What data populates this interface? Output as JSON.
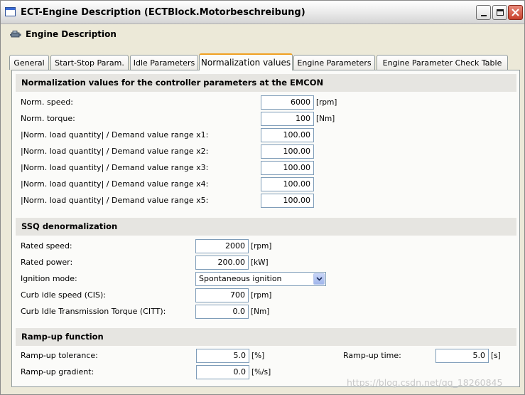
{
  "window": {
    "title": "ECT-Engine Description (ECTBlock.Motorbeschreibung)"
  },
  "header": {
    "title": "Engine Description"
  },
  "tabs": [
    {
      "label": "General"
    },
    {
      "label": "Start-Stop Param."
    },
    {
      "label": "Idle Parameters"
    },
    {
      "label": "Normalization values",
      "active": true
    },
    {
      "label": "Engine Parameters"
    },
    {
      "label": "Engine Parameter Check Table"
    }
  ],
  "norm": {
    "heading": "Normalization values for the controller parameters at the EMCON",
    "rows": [
      {
        "label": "Norm. speed:",
        "value": "6000",
        "unit": "[rpm]"
      },
      {
        "label": "Norm. torque:",
        "value": "100",
        "unit": "[Nm]"
      },
      {
        "label": "|Norm. load quantity| / Demand value range x1:",
        "value": "100.00",
        "unit": ""
      },
      {
        "label": "|Norm. load quantity| / Demand value range x2:",
        "value": "100.00",
        "unit": ""
      },
      {
        "label": "|Norm. load quantity| / Demand value range x3:",
        "value": "100.00",
        "unit": ""
      },
      {
        "label": "|Norm. load quantity| / Demand value range x4:",
        "value": "100.00",
        "unit": ""
      },
      {
        "label": "|Norm. load quantity| / Demand value range x5:",
        "value": "100.00",
        "unit": ""
      }
    ]
  },
  "ssq": {
    "heading": "SSQ denormalization",
    "rated_speed": {
      "label": "Rated speed:",
      "value": "2000",
      "unit": "[rpm]"
    },
    "rated_power": {
      "label": "Rated power:",
      "value": "200.00",
      "unit": "[kW]"
    },
    "ignition": {
      "label": "Ignition mode:",
      "value": "Spontaneous ignition"
    },
    "cis": {
      "label": "Curb idle speed (CIS):",
      "value": "700",
      "unit": "[rpm]"
    },
    "citt": {
      "label": "Curb Idle Transmission Torque (CITT):",
      "value": "0.0",
      "unit": "[Nm]"
    }
  },
  "ramp": {
    "heading": "Ramp-up function",
    "tolerance": {
      "label": "Ramp-up tolerance:",
      "value": "5.0",
      "unit": "[%]"
    },
    "gradient": {
      "label": "Ramp-up gradient:",
      "value": "0.0",
      "unit": "[%/s]"
    },
    "time": {
      "label": "Ramp-up time:",
      "value": "5.0",
      "unit": "[s]"
    }
  },
  "watermark": "https://blog.csdn.net/qq_18260845"
}
